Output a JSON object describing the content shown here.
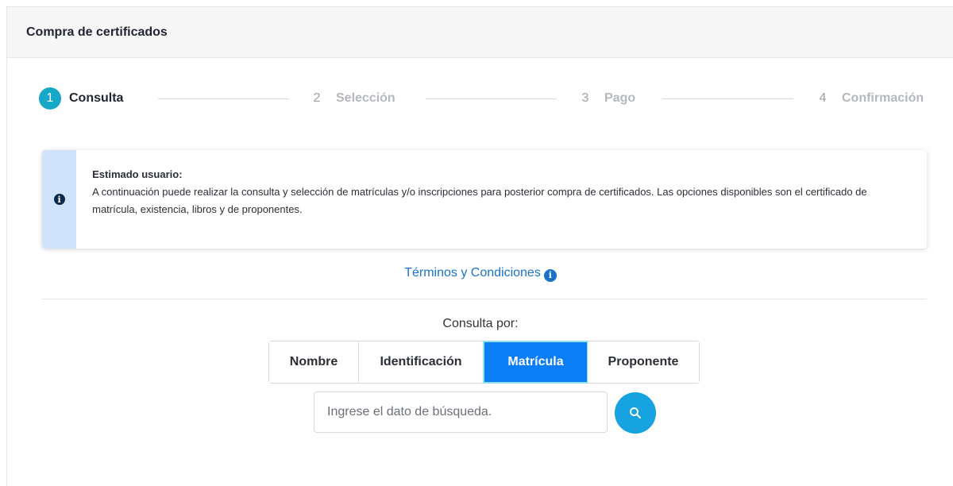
{
  "header": {
    "title": "Compra de certificados"
  },
  "stepper": {
    "steps": [
      {
        "number": "1",
        "label": "Consulta",
        "active": true
      },
      {
        "number": "2",
        "label": "Selección",
        "active": false
      },
      {
        "number": "3",
        "label": "Pago",
        "active": false
      },
      {
        "number": "4",
        "label": "Confirmación",
        "active": false
      }
    ]
  },
  "alert": {
    "icon": "info-icon",
    "title": "Estimado usuario:",
    "text": "A continuación puede realizar la consulta y selección de matrículas y/o inscripciones para posterior compra de certificados. Las opciones disponibles son el certificado de matrícula, existencia, libros y de proponentes."
  },
  "terms": {
    "label": "Términos y Condiciones",
    "icon": "info-icon"
  },
  "query": {
    "label": "Consulta por:",
    "options": [
      "Nombre",
      "Identificación",
      "Matrícula",
      "Proponente"
    ],
    "selected": "Matrícula"
  },
  "search": {
    "placeholder": "Ingrese el dato de búsqueda.",
    "value": "",
    "button_icon": "search-icon"
  },
  "colors": {
    "accent": "#17a7c9",
    "selected_option": "#0b7df7",
    "link": "#1a73c9",
    "search_button": "#17a2e0",
    "alert_side": "#cfe3fb"
  }
}
